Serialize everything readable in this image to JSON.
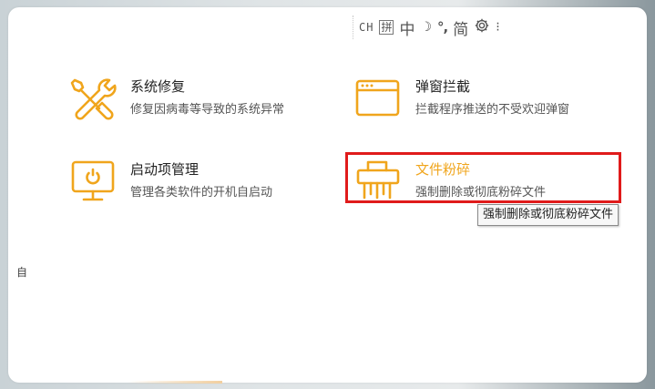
{
  "colors": {
    "accent_orange": "#f0a51c",
    "highlight_red": "#e01b1b",
    "text_primary": "#222222",
    "text_secondary": "#555555"
  },
  "ime_toolbar": {
    "mode": "CH",
    "pinyin": "拼",
    "language": "中",
    "moon": "☽",
    "punct": "°,",
    "script": "简",
    "icons": [
      "ime-settings-gear-icon",
      "ime-more-icon"
    ],
    "more": "⁝"
  },
  "tools": [
    {
      "title": "系统修复",
      "desc": "修复因病毒等导致的系统异常",
      "icon": "wrench-screwdriver-icon"
    },
    {
      "title": "弹窗拦截",
      "desc": "拦截程序推送的不受欢迎弹窗",
      "icon": "popup-window-icon"
    },
    {
      "title": "启动项管理",
      "desc": "管理各类软件的开机自启动",
      "icon": "monitor-startup-icon"
    },
    {
      "title": "文件粉碎",
      "desc": "强制删除或彻底粉碎文件",
      "icon": "paper-shredder-icon",
      "highlighted": true
    }
  ],
  "tooltip": "强制删除或彻底粉碎文件",
  "side_char": "自"
}
